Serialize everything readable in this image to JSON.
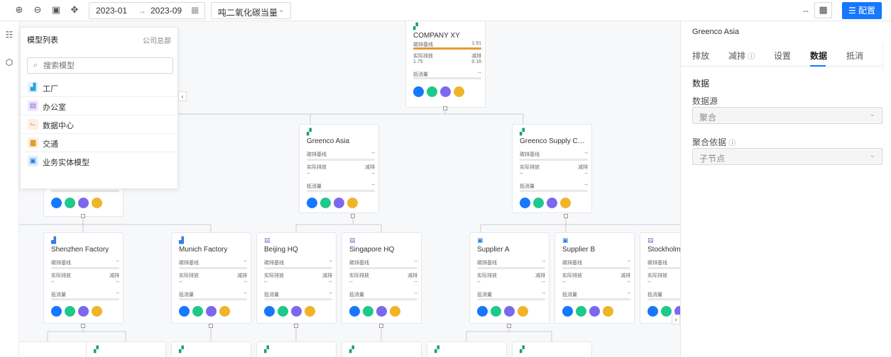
{
  "toolbar": {
    "date_start": "2023-01",
    "date_end": "2023-09",
    "arrow": "→",
    "unit_value": "吨二氧化碳当量",
    "right_dash": "--",
    "config_label": "配置"
  },
  "model_panel": {
    "title": "模型列表",
    "scope": "公司总部",
    "search_placeholder": "搜索模型",
    "items": [
      {
        "label": "工厂",
        "icon": "factory-icon",
        "color": "#2f9fd8",
        "bg": "#e3f3fb"
      },
      {
        "label": "办公室",
        "icon": "office-icon",
        "color": "#8c62d8",
        "bg": "#efe8fb"
      },
      {
        "label": "数据中心",
        "icon": "data-center-icon",
        "color": "#d88a2f",
        "bg": "#fbf0e3"
      },
      {
        "label": "交通",
        "icon": "transport-icon",
        "color": "#e39b2f",
        "bg": "#fcefdc"
      },
      {
        "label": "业务实体模型",
        "icon": "business-entity-icon",
        "color": "#2f7ee8",
        "bg": "#e3eefb"
      }
    ]
  },
  "labels": {
    "baseline": "碳排基线",
    "actual": "实际排放",
    "reduction": "减排",
    "offset": "抵消量",
    "dash": "--"
  },
  "nodes": {
    "company": {
      "title": "COMPANY XY",
      "baseline": "1.91",
      "actual": "1.75",
      "reduction": "0.16"
    },
    "greenco_asia": {
      "title": "Greenco Asia"
    },
    "greenco_supply": {
      "title": "Greenco Supply Chain"
    },
    "shenzhen": {
      "title": "Shenzhen Factory"
    },
    "munich": {
      "title": "Munich Factory"
    },
    "beijing": {
      "title": "Beijing HQ"
    },
    "singapore": {
      "title": "Singapore HQ"
    },
    "supplier_a": {
      "title": "Supplier A"
    },
    "supplier_b": {
      "title": "Supplier B"
    },
    "stockholm": {
      "title": "Stockholm HQ"
    }
  },
  "right_panel": {
    "title": "Greenco Asia",
    "tabs": [
      "排放",
      "减排",
      "设置",
      "数据",
      "抵消"
    ],
    "active_tab": "数据",
    "section": "数据",
    "source_label": "数据源",
    "source_value": "聚合",
    "basis_label": "聚合依据",
    "basis_value": "子节点"
  },
  "colors": {
    "accent": "#1677ff",
    "baseline_bar": "#e8963a",
    "dot_blue": "#1677ff",
    "dot_green": "#1ec98b",
    "dot_purple": "#7b68ee",
    "dot_yellow": "#f0b429"
  }
}
